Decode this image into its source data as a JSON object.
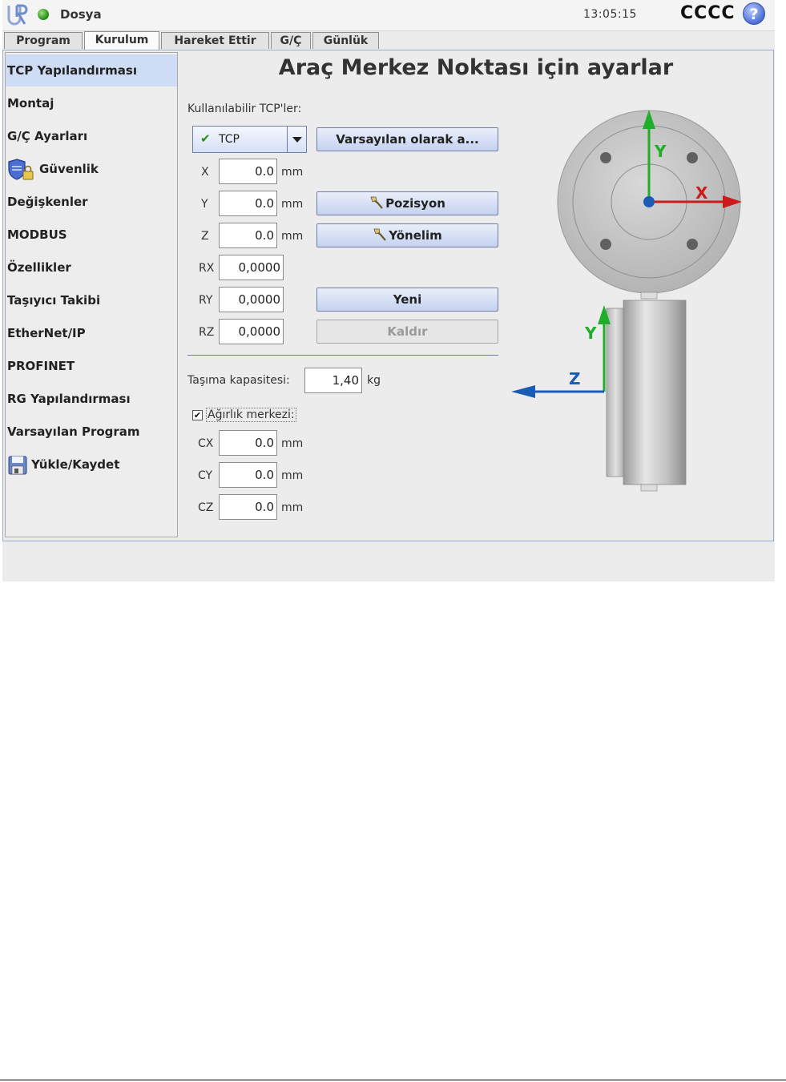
{
  "topbar": {
    "file_menu": "Dosya",
    "clock": "13:05:15",
    "robot_name": "CCCC",
    "help_glyph": "?"
  },
  "tabs": [
    {
      "label": "Program"
    },
    {
      "label": "Kurulum",
      "active": true
    },
    {
      "label": "Hareket Ettir"
    },
    {
      "label": "G/Ç"
    },
    {
      "label": "Günlük"
    }
  ],
  "sidebar": {
    "items": [
      {
        "label": "TCP Yapılandırması",
        "active": true
      },
      {
        "label": "Montaj"
      },
      {
        "label": "G/Ç Ayarları"
      },
      {
        "label": "Güvenlik",
        "icon": "shield-lock-icon"
      },
      {
        "label": "Değişkenler"
      },
      {
        "label": "MODBUS"
      },
      {
        "label": "Özellikler"
      },
      {
        "label": "Taşıyıcı Takibi"
      },
      {
        "label": "EtherNet/IP"
      },
      {
        "label": "PROFINET"
      },
      {
        "label": "RG Yapılandırması"
      },
      {
        "label": "Varsayılan Program"
      },
      {
        "label": "Yükle/Kaydet",
        "icon": "floppy-disk-icon"
      }
    ]
  },
  "main": {
    "title": "Araç Merkez Noktası için ayarlar",
    "available_tcps_label": "Kullanılabilir TCP'ler:",
    "tcp_select": {
      "value": "TCP",
      "check_glyph": "✔"
    },
    "set_default_button": "Varsayılan olarak a...",
    "position_button": "Pozisyon",
    "orientation_button": "Yönelim",
    "new_button": "Yeni",
    "remove_button": "Kaldır",
    "fields": {
      "x": {
        "label": "X",
        "value": "0.0",
        "unit": "mm"
      },
      "y": {
        "label": "Y",
        "value": "0.0",
        "unit": "mm"
      },
      "z": {
        "label": "Z",
        "value": "0.0",
        "unit": "mm"
      },
      "rx": {
        "label": "RX",
        "value": "0,0000"
      },
      "ry": {
        "label": "RY",
        "value": "0,0000"
      },
      "rz": {
        "label": "RZ",
        "value": "0,0000"
      }
    },
    "payload": {
      "label": "Taşıma kapasitesi:",
      "value": "1,40",
      "unit": "kg"
    },
    "cog": {
      "label": "Ağırlık merkezi:",
      "checked": true,
      "check_glyph": "✔",
      "cx": {
        "label": "CX",
        "value": "0.0",
        "unit": "mm"
      },
      "cy": {
        "label": "CY",
        "value": "0.0",
        "unit": "mm"
      },
      "cz": {
        "label": "CZ",
        "value": "0.0",
        "unit": "mm"
      }
    },
    "diagram": {
      "front_x_label": "X",
      "front_y_label": "Y",
      "side_y_label": "Y",
      "side_z_label": "Z"
    }
  },
  "colors": {
    "x_axis": "#cc1b1b",
    "y_axis": "#1fae2a",
    "z_axis": "#1a5cb5",
    "button_top": "#e9effb",
    "button_bottom": "#c5d3f0",
    "active_sidebar": "#cfdcf5"
  }
}
